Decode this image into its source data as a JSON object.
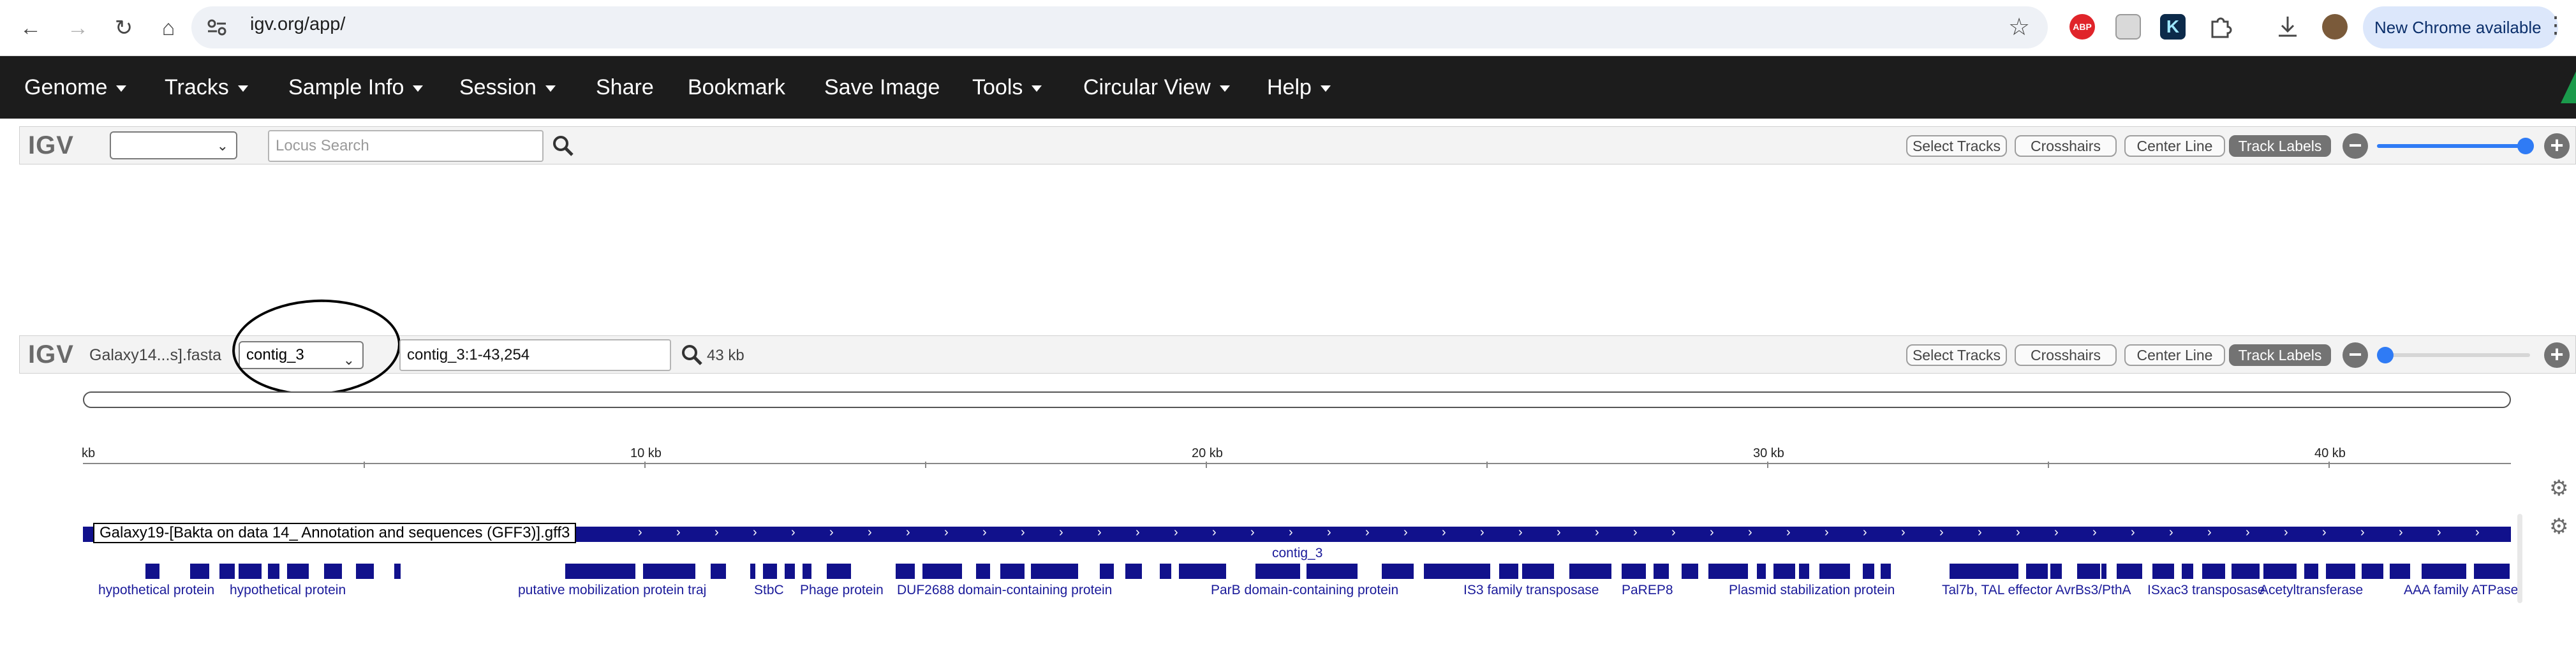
{
  "browser": {
    "url": "igv.org/app/",
    "new_chrome_label": "New Chrome available",
    "menu_dots": "⋮"
  },
  "menubar": {
    "items": [
      {
        "label": "Genome",
        "caret": true
      },
      {
        "label": "Tracks",
        "caret": true
      },
      {
        "label": "Sample Info",
        "caret": true
      },
      {
        "label": "Session",
        "caret": true
      },
      {
        "label": "Share",
        "caret": false
      },
      {
        "label": "Bookmark",
        "caret": false
      },
      {
        "label": "Save Image",
        "caret": false
      },
      {
        "label": "Tools",
        "caret": true
      },
      {
        "label": "Circular View",
        "caret": true
      },
      {
        "label": "Help",
        "caret": true
      }
    ]
  },
  "top_igv": {
    "logo": "IGV",
    "genome_select_value": "",
    "locus_placeholder": "Locus Search",
    "buttons": {
      "select_tracks": "Select Tracks",
      "crosshairs": "Crosshairs",
      "center_line": "Center Line",
      "track_labels": "Track Labels"
    }
  },
  "second_igv": {
    "logo": "IGV",
    "genome_name": "Galaxy14...s].fasta",
    "chromosome_select_value": "contig_3",
    "locus_value": "contig_3:1-43,254",
    "window_size": "43 kb",
    "buttons": {
      "select_tracks": "Select Tracks",
      "crosshairs": "Crosshairs",
      "center_line": "Center Line",
      "track_labels": "Track Labels"
    }
  },
  "ruler": {
    "unit_label": "kb",
    "major_labels": [
      "10 kb",
      "20 kb",
      "30 kb",
      "40 kb"
    ]
  },
  "track": {
    "name": "Galaxy19-[Bakta on data 14_ Annotation and sequences (GFF3)].gff3",
    "contig_label": "contig_3",
    "gene_labels": [
      "hypothetical protein",
      "hypothetical protein",
      "putative mobilization protein traj",
      "StbC",
      "Phage protein",
      "DUF2688 domain-containing protein",
      "ParB domain-containing protein",
      "IS3 family transposase",
      "PaREP8",
      "Plasmid stabilization protein",
      "Tal7b, TAL effector AvrBs3/PthA",
      "ISxac3 transposase",
      "Acetyltransferase",
      "AAA family ATPase"
    ]
  },
  "colors": {
    "feature": "#11118c",
    "label": "#1a1a9a",
    "menubar": "#1c1c1c",
    "slider": "#2f7bf5"
  }
}
